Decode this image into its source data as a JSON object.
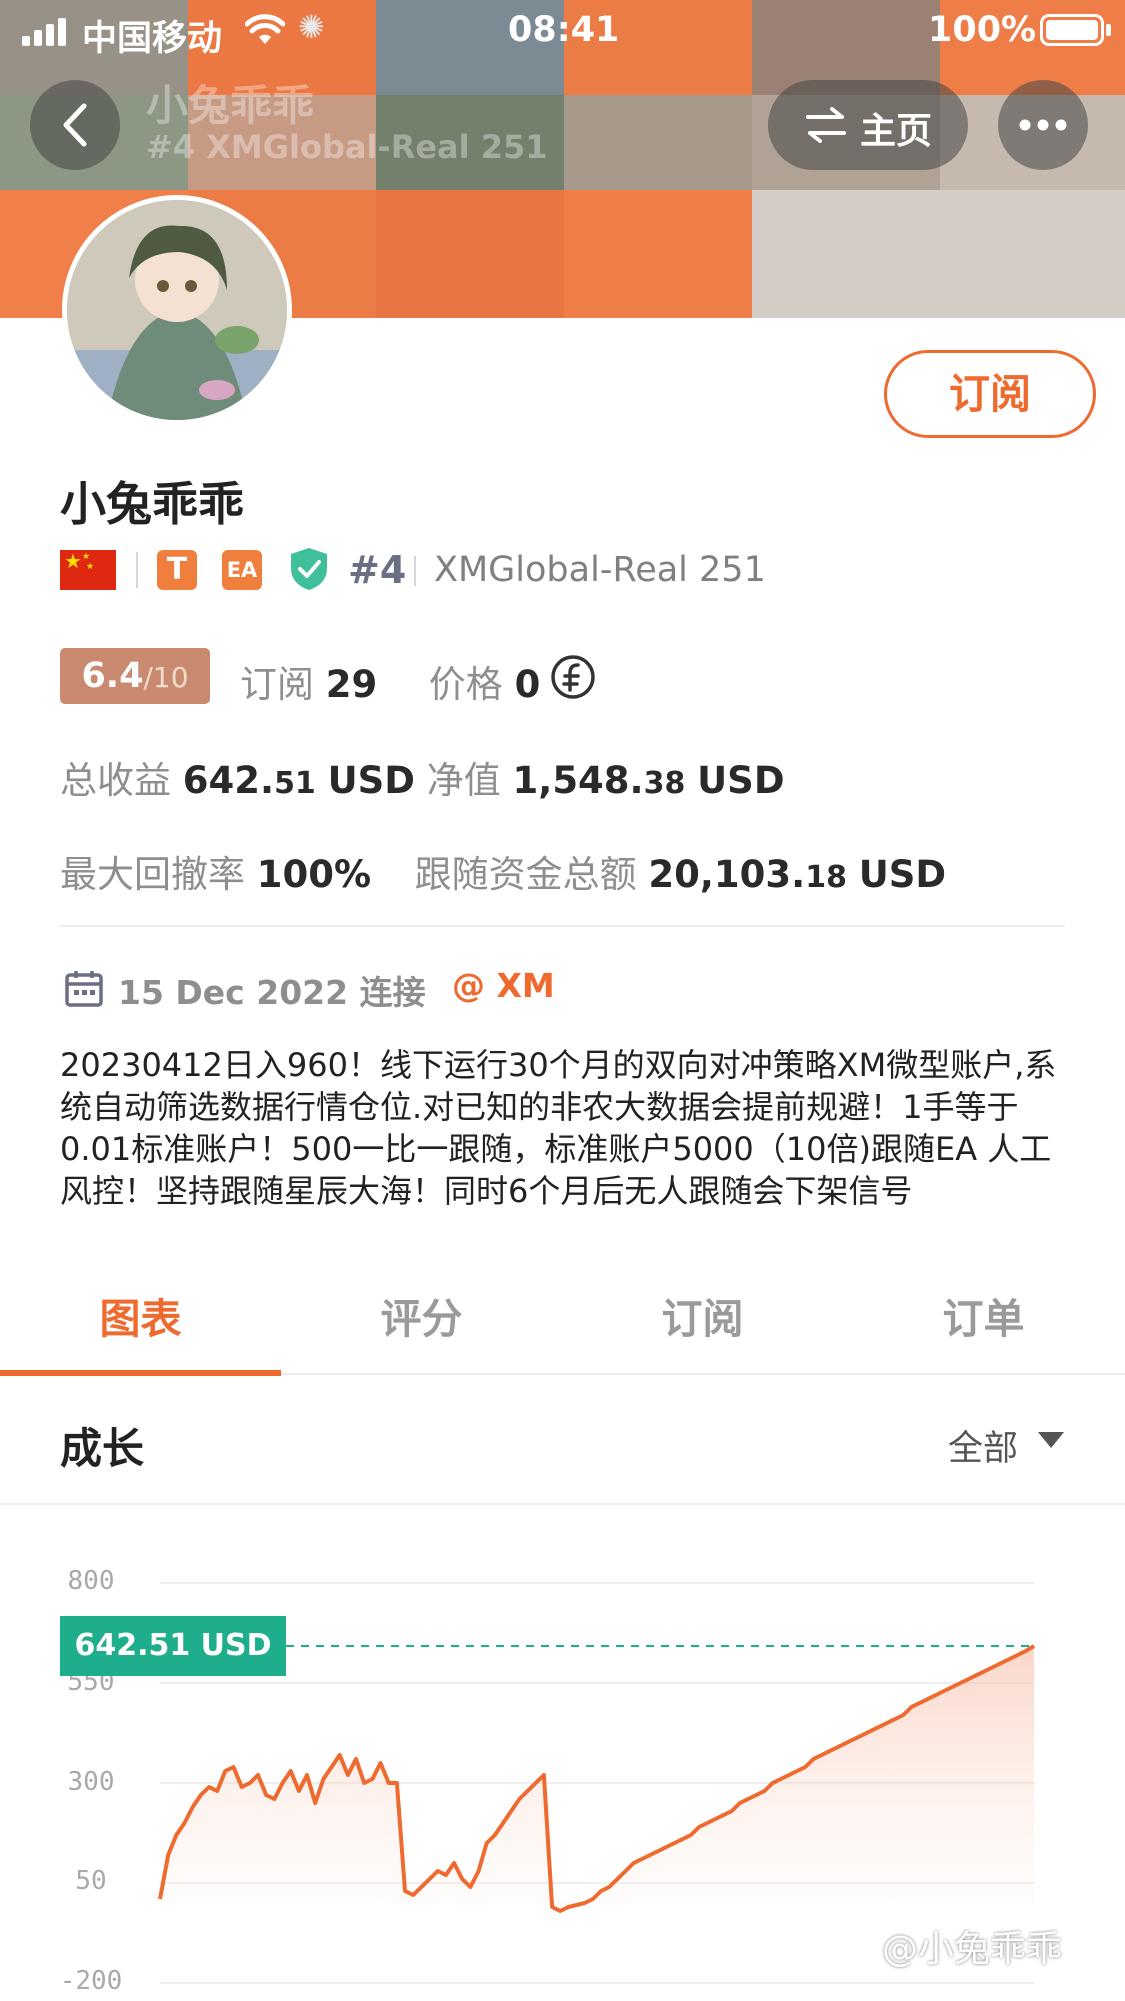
{
  "status_bar": {
    "carrier": "中国移动",
    "time": "08:41",
    "battery": "100%"
  },
  "header": {
    "faded_name": "小兔乖乖",
    "faded_subtitle": "#4 XMGlobal-Real 251",
    "home_label": "主页",
    "back_icon": "chevron-left-icon",
    "more_icon": "more-dots-icon"
  },
  "profile": {
    "subscribe_label": "订阅",
    "name": "小兔乖乖",
    "badge_t": "T",
    "badge_ea": "EA",
    "rank": "#4",
    "account": "XMGlobal-Real 251",
    "rating": "6.4",
    "rating_max": "/10",
    "subs_label": "订阅",
    "subs_value": "29",
    "price_label": "价格",
    "price_value": "0",
    "total_profit_label": "总收益",
    "total_profit_int": "642.",
    "total_profit_dec": "51",
    "total_profit_unit": "USD",
    "equity_label": "净值",
    "equity_int": "1,548.",
    "equity_dec": "38",
    "equity_unit": "USD",
    "max_dd_label": "最大回撤率",
    "max_dd_value": "100%",
    "follow_total_label": "跟随资金总额",
    "follow_total_int": "20,103.",
    "follow_total_dec": "18",
    "follow_total_unit": "USD",
    "connect_date": "15 Dec 2022 连接",
    "broker": "@ XM",
    "description": "20230412日入960！线下运行30个月的双向对冲策略XM微型账户,系统自动筛选数据行情仓位.对已知的非农大数据会提前规避！1手等于0.01标准账户！500一比一跟随，标准账户5000（10倍)跟随EA 人工风控！坚持跟随星辰大海！同时6个月后无人跟随会下架信号"
  },
  "tabs": [
    "图表",
    "评分",
    "订阅",
    "订单"
  ],
  "active_tab_index": 0,
  "section": {
    "title": "成长",
    "filter": "全部"
  },
  "colors": {
    "accent": "#ee6a2f",
    "teal": "#1fae8c",
    "rating_bg": "#c98a6f"
  },
  "watermark": "@小兔乖乖",
  "chart_data": {
    "type": "area",
    "yticks": [
      "800",
      "550",
      "300",
      "50",
      "-200"
    ],
    "ylim": [
      -200,
      800
    ],
    "current_label": "642.51 USD",
    "current_value": 642.51,
    "series": [
      {
        "values": [
          10,
          120,
          170,
          200,
          240,
          270,
          290,
          280,
          330,
          340,
          290,
          300,
          320,
          270,
          260,
          300,
          330,
          280,
          320,
          250,
          310,
          340,
          370,
          320,
          360,
          300,
          310,
          350,
          300,
          300,
          30,
          20,
          40,
          60,
          80,
          70,
          100,
          60,
          40,
          80,
          150,
          170,
          200,
          230,
          260,
          280,
          300,
          320,
          -10,
          -20,
          -10,
          -5,
          0,
          10,
          30,
          40,
          60,
          80,
          100,
          110,
          120,
          130,
          140,
          150,
          160,
          170,
          190,
          200,
          210,
          220,
          230,
          250,
          260,
          270,
          280,
          300,
          310,
          320,
          330,
          340,
          360,
          370,
          380,
          390,
          400,
          410,
          420,
          430,
          440,
          450,
          460,
          470,
          490,
          500,
          510,
          520,
          530,
          540,
          550,
          560,
          570,
          580,
          590,
          600,
          610,
          620,
          630,
          642.51
        ]
      }
    ]
  }
}
